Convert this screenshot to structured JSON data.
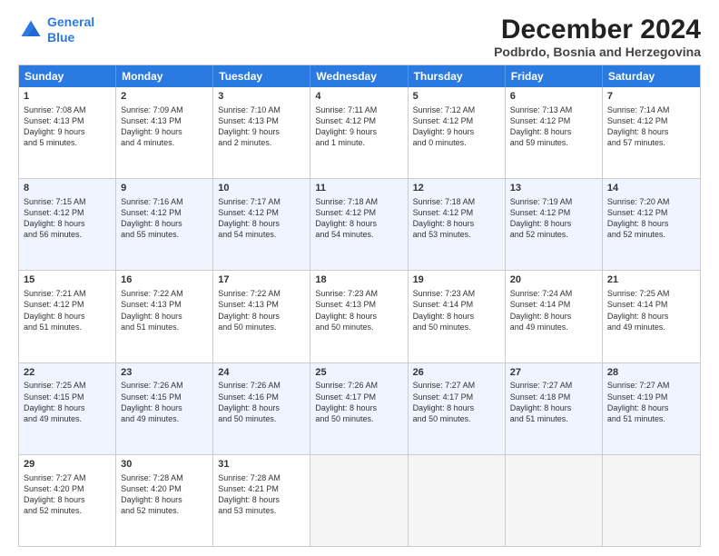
{
  "header": {
    "logo_line1": "General",
    "logo_line2": "Blue",
    "month_title": "December 2024",
    "location": "Podbrdo, Bosnia and Herzegovina"
  },
  "days_of_week": [
    "Sunday",
    "Monday",
    "Tuesday",
    "Wednesday",
    "Thursday",
    "Friday",
    "Saturday"
  ],
  "rows": [
    {
      "alt": false,
      "cells": [
        {
          "day": "1",
          "lines": [
            "Sunrise: 7:08 AM",
            "Sunset: 4:13 PM",
            "Daylight: 9 hours",
            "and 5 minutes."
          ]
        },
        {
          "day": "2",
          "lines": [
            "Sunrise: 7:09 AM",
            "Sunset: 4:13 PM",
            "Daylight: 9 hours",
            "and 4 minutes."
          ]
        },
        {
          "day": "3",
          "lines": [
            "Sunrise: 7:10 AM",
            "Sunset: 4:13 PM",
            "Daylight: 9 hours",
            "and 2 minutes."
          ]
        },
        {
          "day": "4",
          "lines": [
            "Sunrise: 7:11 AM",
            "Sunset: 4:12 PM",
            "Daylight: 9 hours",
            "and 1 minute."
          ]
        },
        {
          "day": "5",
          "lines": [
            "Sunrise: 7:12 AM",
            "Sunset: 4:12 PM",
            "Daylight: 9 hours",
            "and 0 minutes."
          ]
        },
        {
          "day": "6",
          "lines": [
            "Sunrise: 7:13 AM",
            "Sunset: 4:12 PM",
            "Daylight: 8 hours",
            "and 59 minutes."
          ]
        },
        {
          "day": "7",
          "lines": [
            "Sunrise: 7:14 AM",
            "Sunset: 4:12 PM",
            "Daylight: 8 hours",
            "and 57 minutes."
          ]
        }
      ]
    },
    {
      "alt": true,
      "cells": [
        {
          "day": "8",
          "lines": [
            "Sunrise: 7:15 AM",
            "Sunset: 4:12 PM",
            "Daylight: 8 hours",
            "and 56 minutes."
          ]
        },
        {
          "day": "9",
          "lines": [
            "Sunrise: 7:16 AM",
            "Sunset: 4:12 PM",
            "Daylight: 8 hours",
            "and 55 minutes."
          ]
        },
        {
          "day": "10",
          "lines": [
            "Sunrise: 7:17 AM",
            "Sunset: 4:12 PM",
            "Daylight: 8 hours",
            "and 54 minutes."
          ]
        },
        {
          "day": "11",
          "lines": [
            "Sunrise: 7:18 AM",
            "Sunset: 4:12 PM",
            "Daylight: 8 hours",
            "and 54 minutes."
          ]
        },
        {
          "day": "12",
          "lines": [
            "Sunrise: 7:18 AM",
            "Sunset: 4:12 PM",
            "Daylight: 8 hours",
            "and 53 minutes."
          ]
        },
        {
          "day": "13",
          "lines": [
            "Sunrise: 7:19 AM",
            "Sunset: 4:12 PM",
            "Daylight: 8 hours",
            "and 52 minutes."
          ]
        },
        {
          "day": "14",
          "lines": [
            "Sunrise: 7:20 AM",
            "Sunset: 4:12 PM",
            "Daylight: 8 hours",
            "and 52 minutes."
          ]
        }
      ]
    },
    {
      "alt": false,
      "cells": [
        {
          "day": "15",
          "lines": [
            "Sunrise: 7:21 AM",
            "Sunset: 4:12 PM",
            "Daylight: 8 hours",
            "and 51 minutes."
          ]
        },
        {
          "day": "16",
          "lines": [
            "Sunrise: 7:22 AM",
            "Sunset: 4:13 PM",
            "Daylight: 8 hours",
            "and 51 minutes."
          ]
        },
        {
          "day": "17",
          "lines": [
            "Sunrise: 7:22 AM",
            "Sunset: 4:13 PM",
            "Daylight: 8 hours",
            "and 50 minutes."
          ]
        },
        {
          "day": "18",
          "lines": [
            "Sunrise: 7:23 AM",
            "Sunset: 4:13 PM",
            "Daylight: 8 hours",
            "and 50 minutes."
          ]
        },
        {
          "day": "19",
          "lines": [
            "Sunrise: 7:23 AM",
            "Sunset: 4:14 PM",
            "Daylight: 8 hours",
            "and 50 minutes."
          ]
        },
        {
          "day": "20",
          "lines": [
            "Sunrise: 7:24 AM",
            "Sunset: 4:14 PM",
            "Daylight: 8 hours",
            "and 49 minutes."
          ]
        },
        {
          "day": "21",
          "lines": [
            "Sunrise: 7:25 AM",
            "Sunset: 4:14 PM",
            "Daylight: 8 hours",
            "and 49 minutes."
          ]
        }
      ]
    },
    {
      "alt": true,
      "cells": [
        {
          "day": "22",
          "lines": [
            "Sunrise: 7:25 AM",
            "Sunset: 4:15 PM",
            "Daylight: 8 hours",
            "and 49 minutes."
          ]
        },
        {
          "day": "23",
          "lines": [
            "Sunrise: 7:26 AM",
            "Sunset: 4:15 PM",
            "Daylight: 8 hours",
            "and 49 minutes."
          ]
        },
        {
          "day": "24",
          "lines": [
            "Sunrise: 7:26 AM",
            "Sunset: 4:16 PM",
            "Daylight: 8 hours",
            "and 50 minutes."
          ]
        },
        {
          "day": "25",
          "lines": [
            "Sunrise: 7:26 AM",
            "Sunset: 4:17 PM",
            "Daylight: 8 hours",
            "and 50 minutes."
          ]
        },
        {
          "day": "26",
          "lines": [
            "Sunrise: 7:27 AM",
            "Sunset: 4:17 PM",
            "Daylight: 8 hours",
            "and 50 minutes."
          ]
        },
        {
          "day": "27",
          "lines": [
            "Sunrise: 7:27 AM",
            "Sunset: 4:18 PM",
            "Daylight: 8 hours",
            "and 51 minutes."
          ]
        },
        {
          "day": "28",
          "lines": [
            "Sunrise: 7:27 AM",
            "Sunset: 4:19 PM",
            "Daylight: 8 hours",
            "and 51 minutes."
          ]
        }
      ]
    },
    {
      "alt": false,
      "cells": [
        {
          "day": "29",
          "lines": [
            "Sunrise: 7:27 AM",
            "Sunset: 4:20 PM",
            "Daylight: 8 hours",
            "and 52 minutes."
          ]
        },
        {
          "day": "30",
          "lines": [
            "Sunrise: 7:28 AM",
            "Sunset: 4:20 PM",
            "Daylight: 8 hours",
            "and 52 minutes."
          ]
        },
        {
          "day": "31",
          "lines": [
            "Sunrise: 7:28 AM",
            "Sunset: 4:21 PM",
            "Daylight: 8 hours",
            "and 53 minutes."
          ]
        },
        {
          "day": "",
          "lines": []
        },
        {
          "day": "",
          "lines": []
        },
        {
          "day": "",
          "lines": []
        },
        {
          "day": "",
          "lines": []
        }
      ]
    }
  ]
}
